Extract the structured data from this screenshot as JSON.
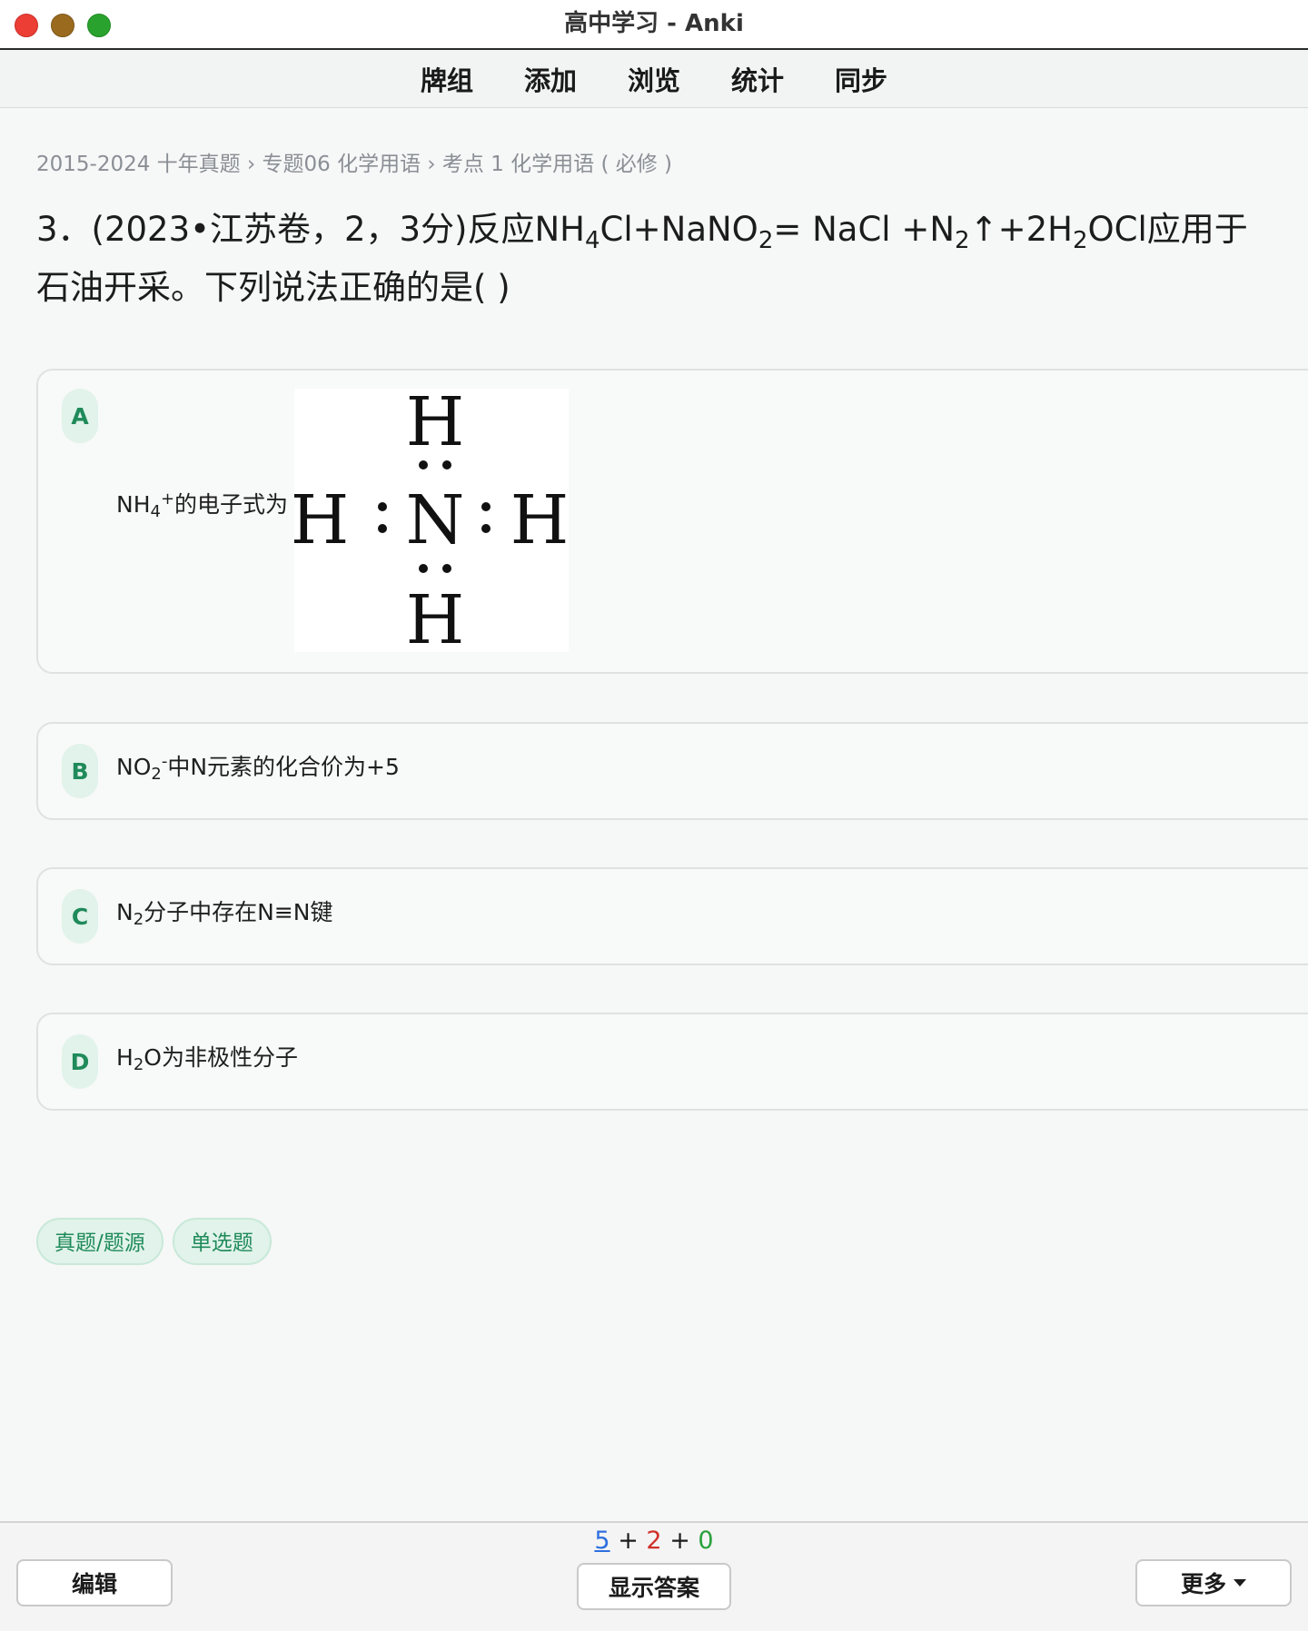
{
  "window": {
    "title": "高中学习 - Anki"
  },
  "toolbar": {
    "items": [
      "牌组",
      "添加",
      "浏览",
      "统计",
      "同步"
    ]
  },
  "breadcrumb": "2015-2024 十年真题 › 专题06 化学用语 › 考点 1 化学用语 ( 必修 )",
  "question": {
    "p1": "3．(2023•江苏卷，2，3分)反应NH",
    "s1": "4",
    "p2": "Cl+NaNO",
    "s2": "2",
    "p3": "= NaCl +N",
    "s3": "2",
    "p4": "↑+2H",
    "s4": "2",
    "p5": "OCl应用于石油开采。下列说法正确的是( )"
  },
  "options": [
    {
      "letter": "A",
      "t1": "NH",
      "sub": "4",
      "sup": "+",
      "t2": "的电子式为"
    },
    {
      "letter": "B",
      "t1": "NO",
      "sub": "2",
      "sup": "-",
      "t2": "中N元素的化合价为+5"
    },
    {
      "letter": "C",
      "t1": "N",
      "sub": "2",
      "t2": "分子中存在N≡N键"
    },
    {
      "letter": "D",
      "t1": "H",
      "sub": "2",
      "t2": "O为非极性分子"
    }
  ],
  "lewis": {
    "center": "N",
    "top": "H",
    "bottom": "H",
    "left": "H",
    "right": "H"
  },
  "tags": [
    "真题/题源",
    "单选题"
  ],
  "footer": {
    "edit": "编辑",
    "show_answer": "显示答案",
    "more": "更多",
    "counts": {
      "new": "5",
      "learn": "2",
      "review": "0",
      "sep": "+"
    }
  },
  "colors": {
    "accent_green": "#1f8a5a",
    "new": "#2f6fde",
    "learn": "#d0302a",
    "review": "#2aa13c"
  }
}
